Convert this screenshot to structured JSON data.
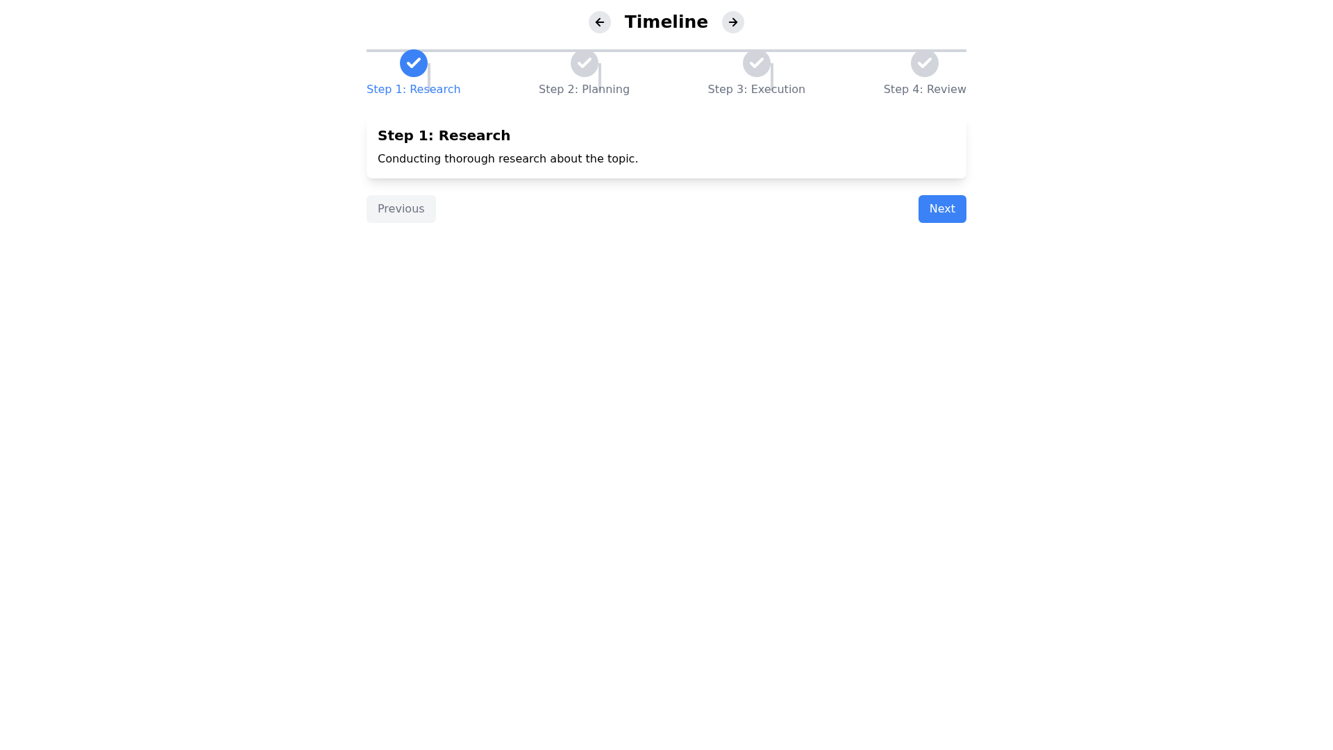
{
  "header": {
    "title": "Timeline"
  },
  "steps": [
    {
      "label": "Step 1: Research",
      "selected": true
    },
    {
      "label": "Step 2: Planning",
      "selected": false
    },
    {
      "label": "Step 3: Execution",
      "selected": false
    },
    {
      "label": "Step 4: Review",
      "selected": false
    }
  ],
  "card": {
    "title": "Step 1: Research",
    "description": "Conducting thorough research about the topic."
  },
  "buttons": [
    {
      "label": "Previous",
      "disabled": true
    },
    {
      "label": "Next",
      "disabled": false
    }
  ]
}
